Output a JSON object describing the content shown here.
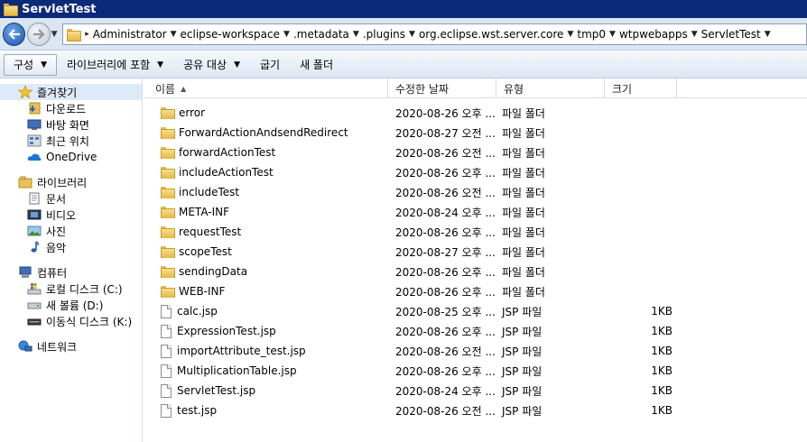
{
  "window": {
    "title": "ServletTest"
  },
  "address": {
    "crumbs": [
      "Administrator",
      "eclipse-workspace",
      ".metadata",
      ".plugins",
      "org.eclipse.wst.server.core",
      "tmp0",
      "wtpwebapps",
      "ServletTest"
    ]
  },
  "toolbar": {
    "organize": "구성",
    "include_library": "라이브러리에 포함",
    "share": "공유 대상",
    "burn": "굽기",
    "new_folder": "새 폴더"
  },
  "nav": {
    "favorites": {
      "label": "즐겨찾기",
      "items": [
        "다운로드",
        "바탕 화면",
        "최근 위치",
        "OneDrive"
      ]
    },
    "libraries": {
      "label": "라이브러리",
      "items": [
        "문서",
        "비디오",
        "사진",
        "음악"
      ]
    },
    "computer": {
      "label": "컴퓨터",
      "items": [
        "로컬 디스크 (C:)",
        "새 볼륨 (D:)",
        "이동식 디스크 (K:)"
      ]
    },
    "network": {
      "label": "네트워크"
    }
  },
  "columns": {
    "name": "이름",
    "modified": "수정한 날짜",
    "type": "유형",
    "size": "크기"
  },
  "files": [
    {
      "name": "error",
      "modified": "2020-08-26 오후 ...",
      "type": "파일 폴더",
      "size": "",
      "kind": "folder"
    },
    {
      "name": "ForwardActionAndsendRedirect",
      "modified": "2020-08-27 오전 ...",
      "type": "파일 폴더",
      "size": "",
      "kind": "folder"
    },
    {
      "name": "forwardActionTest",
      "modified": "2020-08-26 오전 ...",
      "type": "파일 폴더",
      "size": "",
      "kind": "folder"
    },
    {
      "name": "includeActionTest",
      "modified": "2020-08-26 오후 ...",
      "type": "파일 폴더",
      "size": "",
      "kind": "folder"
    },
    {
      "name": "includeTest",
      "modified": "2020-08-26 오전 ...",
      "type": "파일 폴더",
      "size": "",
      "kind": "folder"
    },
    {
      "name": "META-INF",
      "modified": "2020-08-24 오후 ...",
      "type": "파일 폴더",
      "size": "",
      "kind": "folder"
    },
    {
      "name": "requestTest",
      "modified": "2020-08-26 오후 ...",
      "type": "파일 폴더",
      "size": "",
      "kind": "folder"
    },
    {
      "name": "scopeTest",
      "modified": "2020-08-27 오후 ...",
      "type": "파일 폴더",
      "size": "",
      "kind": "folder"
    },
    {
      "name": "sendingData",
      "modified": "2020-08-26 오후 ...",
      "type": "파일 폴더",
      "size": "",
      "kind": "folder"
    },
    {
      "name": "WEB-INF",
      "modified": "2020-08-26 오후 ...",
      "type": "파일 폴더",
      "size": "",
      "kind": "folder"
    },
    {
      "name": "calc.jsp",
      "modified": "2020-08-25 오후 ...",
      "type": "JSP 파일",
      "size": "1KB",
      "kind": "file"
    },
    {
      "name": "ExpressionTest.jsp",
      "modified": "2020-08-26 오후 ...",
      "type": "JSP 파일",
      "size": "1KB",
      "kind": "file"
    },
    {
      "name": "importAttribute_test.jsp",
      "modified": "2020-08-26 오전 ...",
      "type": "JSP 파일",
      "size": "1KB",
      "kind": "file"
    },
    {
      "name": "MultiplicationTable.jsp",
      "modified": "2020-08-26 오후 ...",
      "type": "JSP 파일",
      "size": "1KB",
      "kind": "file"
    },
    {
      "name": "ServletTest.jsp",
      "modified": "2020-08-24 오후 ...",
      "type": "JSP 파일",
      "size": "1KB",
      "kind": "file"
    },
    {
      "name": "test.jsp",
      "modified": "2020-08-26 오전 ...",
      "type": "JSP 파일",
      "size": "1KB",
      "kind": "file"
    }
  ]
}
